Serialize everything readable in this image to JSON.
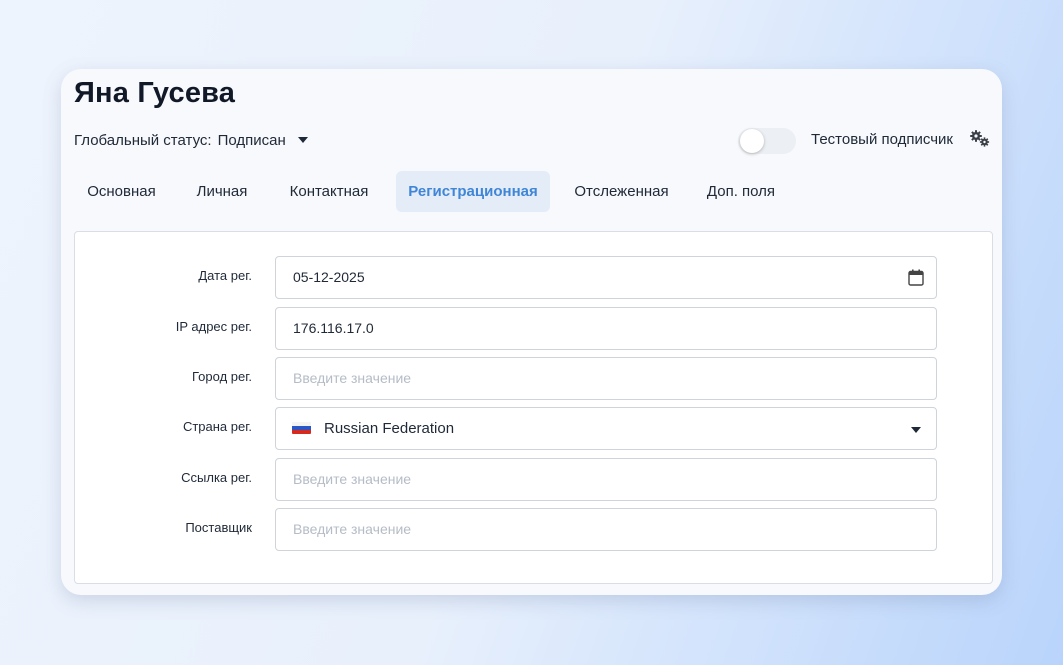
{
  "contact": {
    "name": "Яна Гусева",
    "status_label": "Глобальный статус:",
    "status_value": "Подписан",
    "test_label": "Тестовый подписчик"
  },
  "tabs": [
    {
      "label": "Основная"
    },
    {
      "label": "Личная"
    },
    {
      "label": "Контактная"
    },
    {
      "label": "Регистрационная",
      "active": true
    },
    {
      "label": "Отслеженная"
    },
    {
      "label": "Доп. поля"
    }
  ],
  "form": {
    "reg_date": {
      "label": "Дата рег.",
      "value": "05-12-2025"
    },
    "reg_ip": {
      "label": "IP адрес рег.",
      "value": "176.116.17.0"
    },
    "reg_city": {
      "label": "Город рег.",
      "placeholder": "Введите значение"
    },
    "reg_country": {
      "label": "Страна рег.",
      "value": "Russian Federation"
    },
    "reg_link": {
      "label": "Ссылка рег.",
      "placeholder": "Введите значение"
    },
    "provider": {
      "label": "Поставщик",
      "placeholder": "Введите значение"
    }
  },
  "colors": {
    "accent": "#3f86d6",
    "active_tab_bg": "#e4ecf8",
    "placeholder": "#b5bcc6"
  }
}
